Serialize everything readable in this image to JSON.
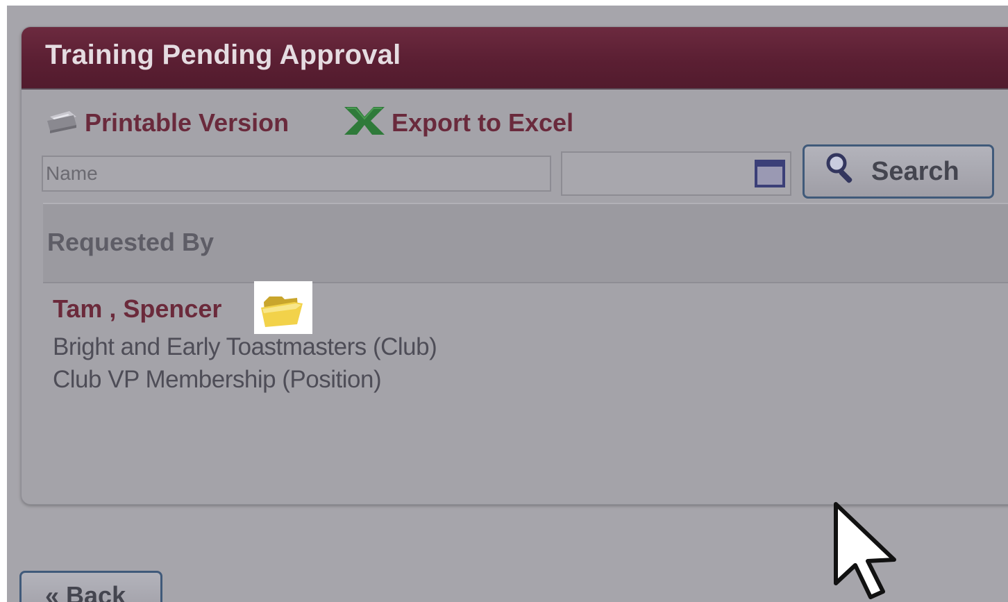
{
  "panel": {
    "title": "Training Pending Approval"
  },
  "toolbar": {
    "printable_label": "Printable Version",
    "export_label": "Export to Excel"
  },
  "filters": {
    "name_placeholder": "Name",
    "name_value": "",
    "date_value": "",
    "search_label": "Search"
  },
  "table": {
    "columns": [
      "Requested By"
    ],
    "rows": [
      {
        "name": "Tam , Spencer",
        "club": "Bright and Early Toastmasters (Club)",
        "position": "Club VP Membership (Position)"
      }
    ]
  },
  "footer": {
    "back_label": "« Back"
  },
  "colors": {
    "header_bg": "#5b1f33",
    "link_text": "#6a2a3c",
    "overlay_bg": "#a6a5ab"
  },
  "icons": {
    "printer": "printer-icon",
    "excel": "excel-icon",
    "calendar": "calendar-icon",
    "search": "search-icon",
    "folder": "folder-icon",
    "cursor": "mouse-pointer-icon"
  }
}
